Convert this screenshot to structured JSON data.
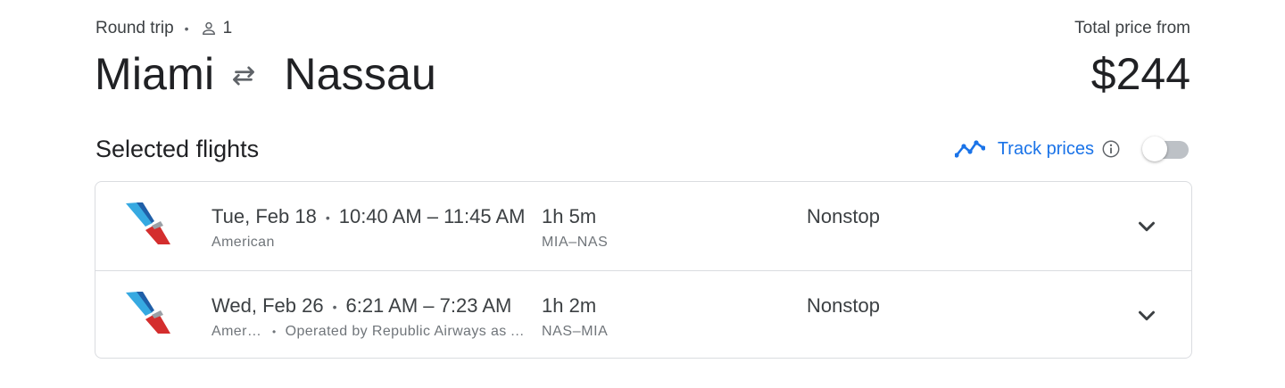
{
  "header": {
    "trip_type": "Round trip",
    "passengers": "1",
    "origin": "Miami",
    "destination": "Nassau",
    "price_label": "Total price from",
    "price": "$244"
  },
  "section": {
    "title": "Selected flights",
    "track_label": "Track prices",
    "track_enabled": false
  },
  "flights": [
    {
      "date": "Tue, Feb 18",
      "times": "10:40 AM – 11:45 AM",
      "airline": "American",
      "operated_by": "",
      "duration": "1h 5m",
      "route": "MIA–NAS",
      "stops": "Nonstop"
    },
    {
      "date": "Wed, Feb 26",
      "times": "6:21 AM – 7:23 AM",
      "airline": "American",
      "operated_by": "Operated by Republic Airways as American Eagle",
      "duration": "1h 2m",
      "route": "NAS–MIA",
      "stops": "Nonstop"
    }
  ],
  "colors": {
    "accent": "#1a73e8",
    "text": "#202124",
    "secondary": "#70757a",
    "border": "#dadce0",
    "logo_blue": "#36a9e1",
    "logo_red": "#d42e2e"
  },
  "icons": {
    "passenger": "person-icon",
    "swap": "swap-arrows-icon",
    "trend": "trend-line-icon",
    "info": "info-icon",
    "expand": "chevron-down-icon"
  }
}
